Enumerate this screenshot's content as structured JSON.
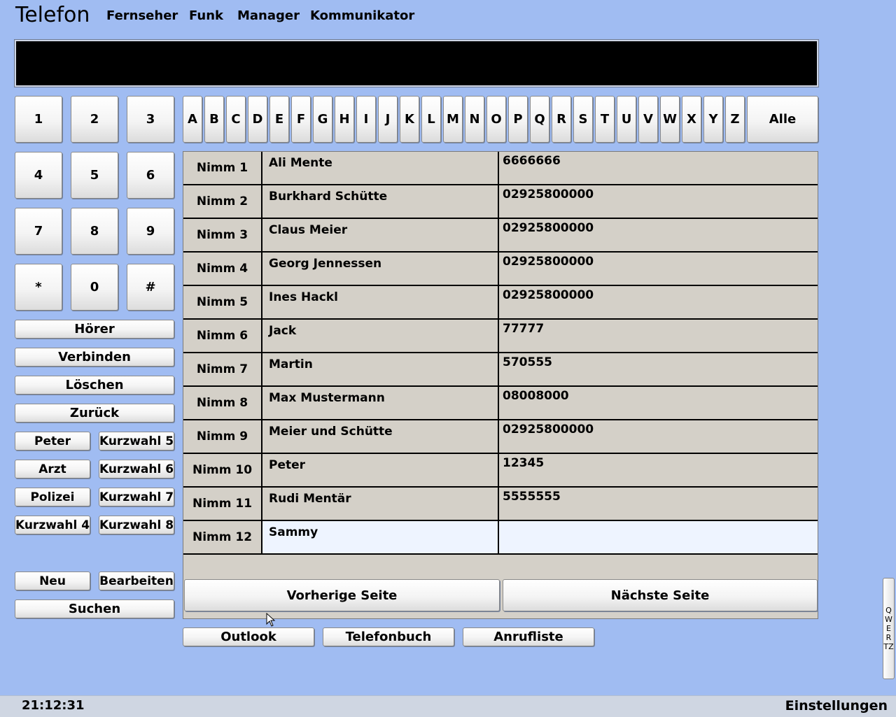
{
  "header": {
    "title": "Telefon",
    "menu": [
      "Fernseher",
      "Funk",
      "Manager",
      "Kommunikator"
    ]
  },
  "keypad": [
    "1",
    "2",
    "3",
    "4",
    "5",
    "6",
    "7",
    "8",
    "9",
    "*",
    "0",
    "#"
  ],
  "actions": {
    "hoerer": "Hörer",
    "verbinden": "Verbinden",
    "loeschen": "Löschen",
    "zurueck": "Zurück"
  },
  "speed_dial": [
    "Peter",
    "Kurzwahl 5",
    "Arzt",
    "Kurzwahl 6",
    "Polizei",
    "Kurzwahl 7",
    "Kurzwahl 4",
    "Kurzwahl 8"
  ],
  "edit": {
    "neu": "Neu",
    "bearbeiten": "Bearbeiten",
    "suchen": "Suchen"
  },
  "alphabet": [
    "A",
    "B",
    "C",
    "D",
    "E",
    "F",
    "G",
    "H",
    "I",
    "J",
    "K",
    "L",
    "M",
    "N",
    "O",
    "P",
    "Q",
    "R",
    "S",
    "T",
    "U",
    "V",
    "W",
    "X",
    "Y",
    "Z"
  ],
  "alle": "Alle",
  "contacts": [
    {
      "nimm": "Nimm 1",
      "name": "Ali Mente",
      "number": "6666666"
    },
    {
      "nimm": "Nimm 2",
      "name": "Burkhard Schütte",
      "number": "02925800000"
    },
    {
      "nimm": "Nimm 3",
      "name": "Claus Meier",
      "number": "02925800000"
    },
    {
      "nimm": "Nimm 4",
      "name": "Georg Jennessen",
      "number": "02925800000"
    },
    {
      "nimm": "Nimm 5",
      "name": "Ines Hackl",
      "number": "02925800000"
    },
    {
      "nimm": "Nimm 6",
      "name": "Jack",
      "number": "77777"
    },
    {
      "nimm": "Nimm 7",
      "name": "Martin",
      "number": "570555"
    },
    {
      "nimm": "Nimm 8",
      "name": "Max Mustermann",
      "number": "08008000"
    },
    {
      "nimm": "Nimm 9",
      "name": "Meier und Schütte",
      "number": "02925800000"
    },
    {
      "nimm": "Nimm 10",
      "name": "Peter",
      "number": "12345"
    },
    {
      "nimm": "Nimm 11",
      "name": "Rudi Mentär",
      "number": "5555555"
    },
    {
      "nimm": "Nimm 12",
      "name": "Sammy",
      "number": ""
    }
  ],
  "paging": {
    "prev": "Vorherige Seite",
    "next": "Nächste Seite"
  },
  "sources": [
    "Outlook",
    "Telefonbuch",
    "Anrufliste"
  ],
  "qwertz_letters": [
    "Q",
    "W",
    "E",
    "R",
    "TZ"
  ],
  "status": {
    "clock": "21:12:31",
    "settings": "Einstellungen"
  },
  "colors": {
    "background": "#a0bcf2",
    "display": "#000000",
    "table": "#d4d0c8",
    "selected_row": "#eef4ff"
  }
}
